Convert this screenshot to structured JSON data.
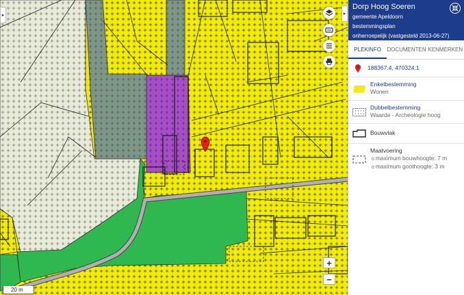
{
  "panel": {
    "title": "Dorp Hoog Soeren",
    "municipality": "gemeente Apeldoorn",
    "plan_type": "bestemmingsplan",
    "status": "onherroepelijk (vastgesteld 2013-06-27)",
    "tabs": [
      {
        "label": "PLEKINFO",
        "active": true
      },
      {
        "label": "DOCUMENTEN",
        "active": false
      },
      {
        "label": "KENMERKEN",
        "active": false
      }
    ],
    "coordinates": "188367.4, 470324.1",
    "enkelbestemming": {
      "heading": "Enkelbestemming",
      "value": "Wonen"
    },
    "dubbelbestemming": {
      "heading": "Dubbelbestemming",
      "value": "Waarde - Archeologie hoog"
    },
    "bouwvlak": {
      "label": "Bouwvlak"
    },
    "maatvoering": {
      "heading": "Maatvoering",
      "items": [
        "maximum bouwhoogte: 7 m",
        "maximum goothoogte: 3 m"
      ]
    }
  },
  "map": {
    "scale_label": "20 m",
    "zoom_in": "+",
    "zoom_out": "−",
    "left_toggle": "▸",
    "right_toggle": "▸",
    "tools": [
      "layers-icon",
      "map-settings-icon",
      "legend-list-icon",
      "print-icon"
    ],
    "colors": {
      "wonen": "#f2ec00",
      "groen": "#2eb84f",
      "agrarisch": "#e8ead8",
      "bos_gray": "#7d9687",
      "maatschappelijk": "#a650c8",
      "verkeer": "#b0b0b0",
      "panel_header": "#1d3d8c",
      "marker": "#e8201a"
    }
  }
}
